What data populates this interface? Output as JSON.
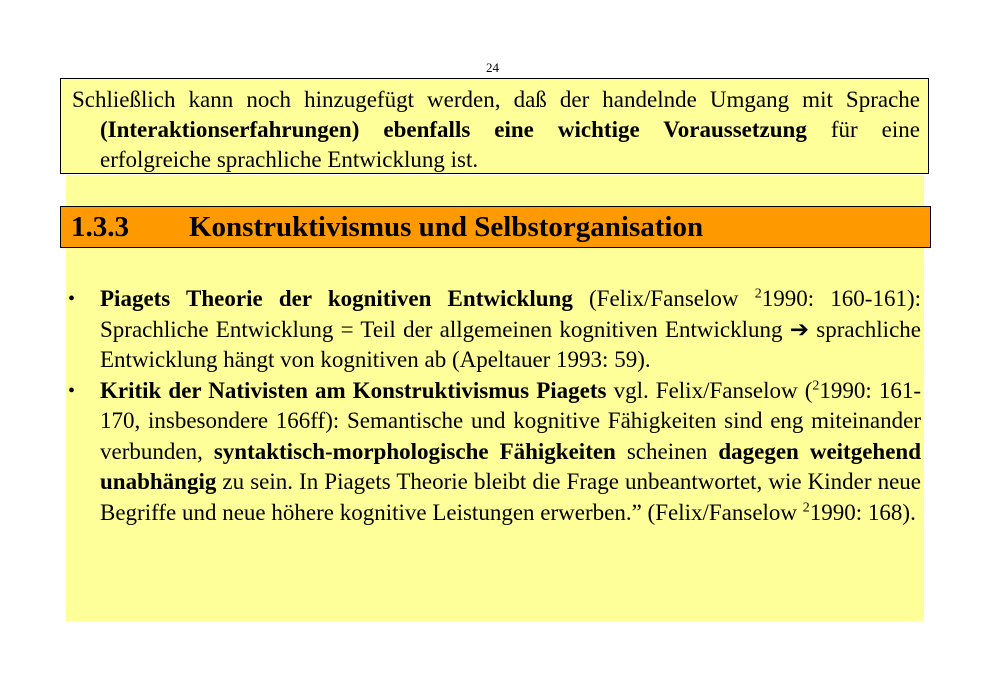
{
  "page_number": "24",
  "top_box": {
    "line1_start": "Schließlich kann noch hinzugefügt werden, daß der handelnde Umgang mit Sprache ",
    "bold1": "(Interaktionserfahrungen) ebenfalls eine wichtige Voraussetzung",
    "line_end": " für eine erfolgreiche sprachliche Entwicklung ist."
  },
  "section": {
    "number": "1.3.3",
    "title": "Konstruktivismus und Selbstorganisation"
  },
  "bullet_glyph": "•",
  "bullets": [
    {
      "bold": "Piagets Theorie der kognitiven Entwicklung",
      "t1": " (Felix/Fanselow ",
      "sup": "2",
      "t2": "1990: 160-161): Sprachliche Entwicklung = Teil der allgemeinen kognitiven Entwicklung ",
      "arrow": "➔",
      "t3": " sprachliche Entwicklung hängt von kognitiven ab (Apeltauer 1993: 59)."
    },
    {
      "bold": "Kritik der Nativisten am Konstruktivismus Piagets",
      "t1": " vgl. Felix/Fanselow (",
      "sup": "2",
      "t2": "1990: 161-170, insbesondere 166ff): Semantische und kognitive Fähigkeiten sind eng miteinander verbunden, ",
      "bold2": "syntaktisch-morphologische Fähigkeiten",
      "t3": " scheinen ",
      "bold3": "dagegen weitgehend unabhängig",
      "t4": " zu sein. In Piagets Theorie bleibt die Frage unbeantwortet, wie Kinder neue Begriffe und neue höhere kognitive Leistungen erwerben.” (Felix/Fanselow ",
      "sup2": "2",
      "t5": "1990: 168)."
    }
  ]
}
